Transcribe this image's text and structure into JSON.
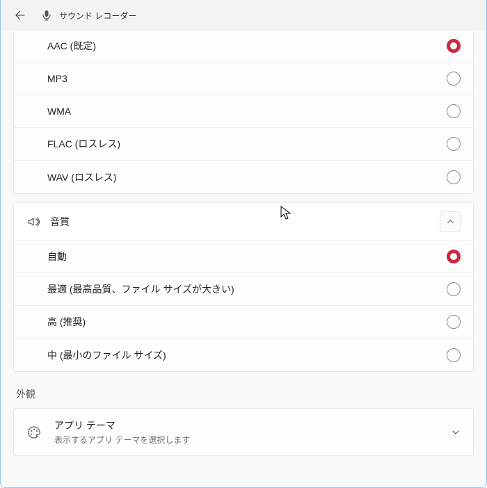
{
  "app": {
    "title": "サウンド レコーダー"
  },
  "format": {
    "options": [
      {
        "label": "AAC (既定)",
        "selected": true
      },
      {
        "label": "MP3",
        "selected": false
      },
      {
        "label": "WMA",
        "selected": false
      },
      {
        "label": "FLAC (ロスレス)",
        "selected": false
      },
      {
        "label": "WAV (ロスレス)",
        "selected": false
      }
    ]
  },
  "quality": {
    "header": "音質",
    "options": [
      {
        "label": "自動",
        "selected": true
      },
      {
        "label": "最適 (最高品質、ファイル サイズが大きい)",
        "selected": false
      },
      {
        "label": "高 (推奨)",
        "selected": false
      },
      {
        "label": "中 (最小のファイル サイズ)",
        "selected": false
      }
    ]
  },
  "appearance": {
    "section": "外観",
    "theme": {
      "title": "アプリ テーマ",
      "subtitle": "表示するアプリ テーマを選択します"
    }
  }
}
